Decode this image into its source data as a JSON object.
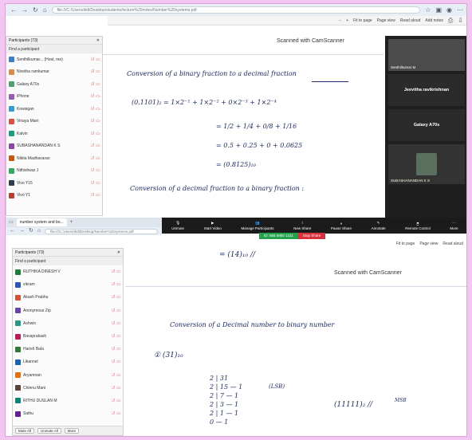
{
  "top_browser": {
    "url": "file:///C:/Users/dell/Desktop/students/lecture%20notes/Number%20systems.pdf",
    "pdf_toolbar": {
      "zoom_minus": "−",
      "zoom_plus": "+",
      "fit": "Fit to page",
      "page_view": "Page view",
      "read_aloud": "Read aloud",
      "add_notes": "Add notes"
    }
  },
  "participants_top": {
    "title": "Participants (73)",
    "find": "Find a participant",
    "items": [
      {
        "name": "Senthilkumar... (Host, me)",
        "color": "#3a7bd5"
      },
      {
        "name": "Nivetha ramkumar",
        "color": "#e08a3c"
      },
      {
        "name": "Galaxy A70s",
        "color": "#4aa36b"
      },
      {
        "name": "iPhone",
        "color": "#9b59b6"
      },
      {
        "name": "Kowsigan",
        "color": "#2d9cdb"
      },
      {
        "name": "Vinaya Mani",
        "color": "#e74c3c"
      },
      {
        "name": "Kalvin",
        "color": "#16a085"
      },
      {
        "name": "SUBASHANANDAN K S",
        "color": "#8e44ad"
      },
      {
        "name": "Nikita Madhavarao",
        "color": "#d35400"
      },
      {
        "name": "Nithishwar J",
        "color": "#27ae60"
      },
      {
        "name": "Vivo Y15",
        "color": "#2c3e50"
      },
      {
        "name": "Vivo Y1",
        "color": "#c0392b"
      }
    ]
  },
  "doc_top": {
    "scanned": "Scanned with CamScanner",
    "heading": "Conversion of a binary fraction to a decimal fraction",
    "line1": "(0.1101)₂ = 1×2⁻¹ + 1×2⁻² + 0×2⁻³ + 1×2⁻⁴",
    "line2": "= 1/2 + 1/4 + 0/8 + 1/16",
    "line3": "= 0.5 + 0.25 + 0 + 0.0625",
    "line4": "= (0.8125)₁₀",
    "heading2": "Conversion of a decimal fraction to a binary fraction :"
  },
  "video_panel": {
    "tile1": "Senthilkumar M",
    "tile2": "Jeevitha ravikrishnan",
    "tile3": "Galaxy A70s",
    "tile4": "SUBASHANANDAN K S"
  },
  "bottom_browser": {
    "tab_label": "number system and bo...",
    "url": "file:///C:/Users/dell/Desktop/Number%20systems.pdf",
    "pdf_toolbar": {
      "fit": "Fit to page",
      "page_view": "Page view",
      "read_aloud": "Read aloud"
    }
  },
  "zoom_toolbar": {
    "unmute": "Unmute",
    "start_video": "Start Video",
    "manage": "Manage Participants",
    "new_share": "New Share",
    "pause": "Pause Share",
    "annotate": "Annotate",
    "remote": "Remote Control",
    "more": "More",
    "meeting_id": "ID: 855 5900 1311",
    "stop_share": "Stop Share"
  },
  "participants_bottom": {
    "title": "Participants (73)",
    "find": "Find a participant",
    "items": [
      {
        "name": "RUTHIKA DINESH V",
        "color": "#1a7f37"
      },
      {
        "name": "vikram",
        "color": "#2455c3"
      },
      {
        "name": "Akash Prabhu",
        "color": "#d9502b"
      },
      {
        "name": "Anonymous Zip",
        "color": "#6e3fb0"
      },
      {
        "name": "Ashwin",
        "color": "#1f9d8c"
      },
      {
        "name": "Bavaprakash",
        "color": "#c2185b"
      },
      {
        "name": "Harish Bala",
        "color": "#2e7d32"
      },
      {
        "name": "Likannel",
        "color": "#1565c0"
      },
      {
        "name": "Aryamnan",
        "color": "#ef6c00"
      },
      {
        "name": "Chinnu Mani",
        "color": "#5d4037"
      },
      {
        "name": "RITHU DUSLAN M",
        "color": "#00897b"
      },
      {
        "name": "Sathu",
        "color": "#6a1b9a"
      }
    ],
    "mute_all": "Mute All",
    "unmute_all": "Unmute All",
    "more": "More"
  },
  "doc_bottom": {
    "top_line": "= (14)₁₀ //",
    "scanned": "Scanned with CamScanner",
    "heading": "Conversion of a Decimal number to binary number",
    "example": "① (31)₁₀",
    "div_rows": [
      "2 | 31",
      "2 | 15  — 1",
      "2 | 7   — 1",
      "2 | 3   — 1",
      "2 | 1   — 1",
      "    0   — 1"
    ],
    "lsb": "(LSB)",
    "result": "(11111)₂ //",
    "msb": "MSB"
  },
  "colors": {
    "page_bg": "#f2c6f0",
    "zoom_green": "#23a24d",
    "zoom_red": "#d8313b",
    "ink": "#1c2a6e"
  }
}
